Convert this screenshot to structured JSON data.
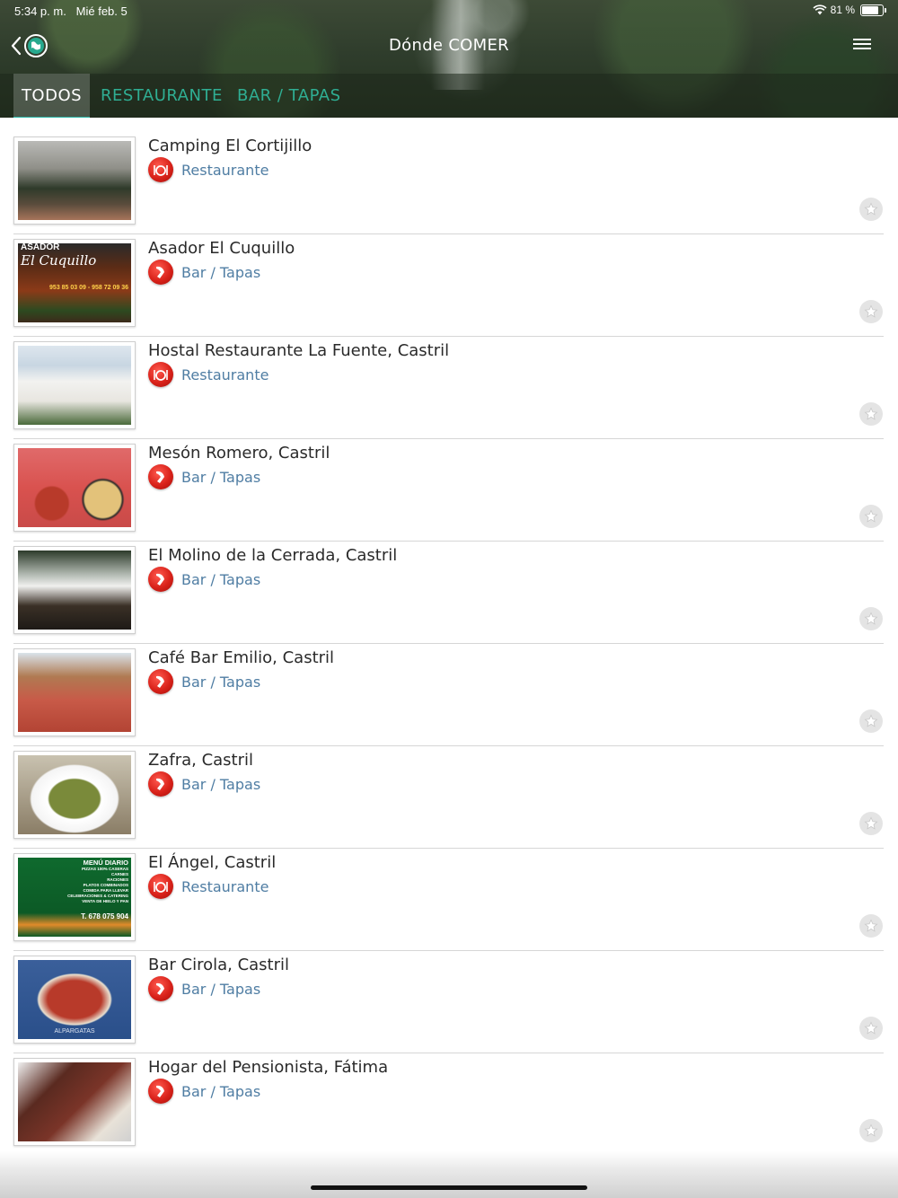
{
  "status_bar": {
    "time": "5:34 p. m.",
    "date": "Mié feb. 5",
    "battery_percent": "81 %",
    "battery_level": 0.81
  },
  "nav": {
    "title": "Dónde COMER",
    "back_icon": "chevron-left-icon",
    "logo_icon": "globe-logo-icon",
    "menu_icon": "hamburger-menu-icon"
  },
  "tabs": [
    {
      "label": "TODOS",
      "active": true
    },
    {
      "label": "RESTAURANTE",
      "active": false
    },
    {
      "label": "BAR / TAPAS",
      "active": false
    }
  ],
  "colors": {
    "accent": "#29b6a7",
    "tab_inactive": "#2fae93",
    "category_text": "#4f7da3",
    "category_icon": "#d9221a"
  },
  "items": [
    {
      "name": "Camping El Cortijillo",
      "category": "Restaurante",
      "icon": "dining-icon"
    },
    {
      "name": "Asador El Cuquillo",
      "category": "Bar / Tapas",
      "icon": "tapas-icon",
      "thumb_text": [
        "ASADOR",
        "El Cuquillo",
        "953 85 03 09 - 958 72 09 36"
      ]
    },
    {
      "name": "Hostal Restaurante La Fuente, Castril",
      "category": "Restaurante",
      "icon": "dining-icon"
    },
    {
      "name": "Mesón Romero, Castril",
      "category": "Bar / Tapas",
      "icon": "tapas-icon"
    },
    {
      "name": "El Molino de la Cerrada, Castril",
      "category": "Bar / Tapas",
      "icon": "tapas-icon"
    },
    {
      "name": "Café Bar Emilio, Castril",
      "category": "Bar / Tapas",
      "icon": "tapas-icon"
    },
    {
      "name": "Zafra, Castril",
      "category": "Bar / Tapas",
      "icon": "tapas-icon"
    },
    {
      "name": "El Ángel, Castril",
      "category": "Restaurante",
      "icon": "dining-icon",
      "thumb_text": [
        "MENÚ DIARIO",
        "PIZZAS 100% CASERAS",
        "CARNES",
        "RACIONES",
        "PLATOS COMBINADOS",
        "COMIDA PARA LLEVAR",
        "CELEBRACIONES & CATERING",
        "VENTA DE HIELO Y PAN",
        "T. 678 075 904"
      ]
    },
    {
      "name": "Bar Cirola, Castril",
      "category": "Bar / Tapas",
      "icon": "tapas-icon",
      "thumb_text": [
        "ALPARGATAS"
      ]
    },
    {
      "name": "Hogar del Pensionista, Fátima",
      "category": "Bar / Tapas",
      "icon": "tapas-icon"
    }
  ]
}
